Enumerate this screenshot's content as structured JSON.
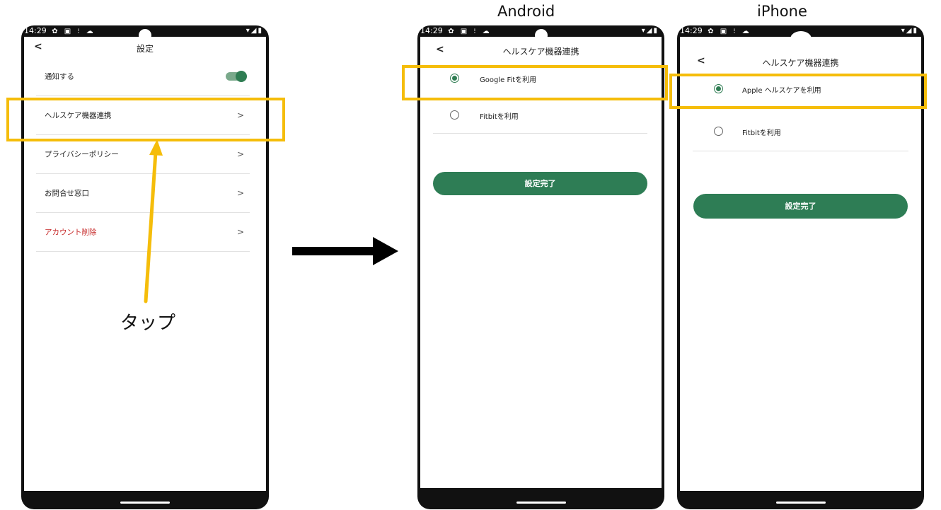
{
  "captions": {
    "android": "Android",
    "iphone": "iPhone",
    "tap": "タップ"
  },
  "status": {
    "time": "14:29",
    "left_icons": "✿ ▣ ⁝ ☁",
    "right_icons": "▾◢▮"
  },
  "settings": {
    "back": "<",
    "title": "設定",
    "rows": [
      {
        "label": "通知する"
      },
      {
        "label": "ヘルスケア機器連携",
        "chevron": ">"
      },
      {
        "label": "プライバシーポリシー",
        "chevron": ">"
      },
      {
        "label": "お問合せ窓口",
        "chevron": ">"
      },
      {
        "label": "アカウント削除",
        "chevron": ">"
      }
    ],
    "notify_toggle_on": true
  },
  "android": {
    "back": "<",
    "title": "ヘルスケア機器連携",
    "options": [
      {
        "label": "Google Fitを利用",
        "selected": true
      },
      {
        "label": "Fitbitを利用",
        "selected": false
      }
    ],
    "button": "設定完了"
  },
  "iphone": {
    "back": "<",
    "title": "ヘルスケア機器連携",
    "options": [
      {
        "label": "Apple ヘルスケアを利用",
        "selected": true
      },
      {
        "label": "Fitbitを利用",
        "selected": false
      }
    ],
    "button": "設定完了"
  },
  "colors": {
    "accent": "#2e7d55",
    "highlight": "#f5bd0a",
    "danger": "#c62828"
  }
}
